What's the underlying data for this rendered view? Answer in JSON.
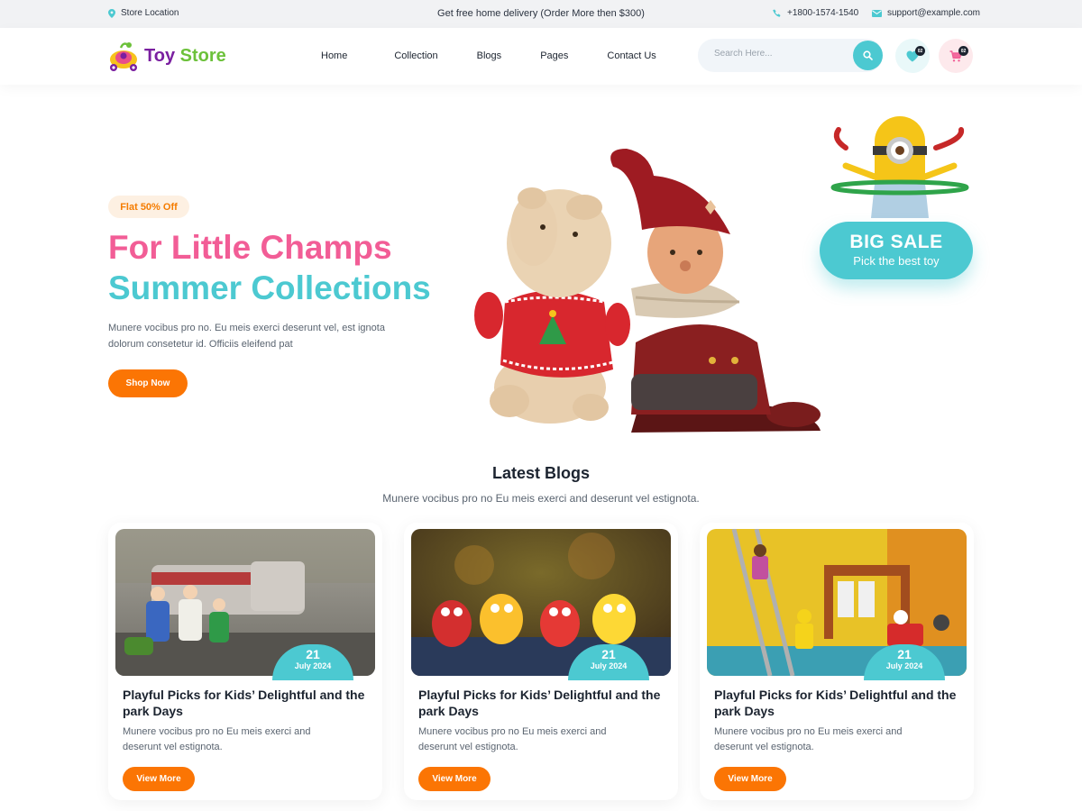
{
  "topbar": {
    "location": "Store Location",
    "promo": "Get free home delivery (Order More then $300)",
    "phone": "+1800-1574-1540",
    "email": "support@example.com"
  },
  "header": {
    "logo_part1": "Toy",
    "logo_part2": "Store",
    "nav": [
      "Home",
      "Collection",
      "Blogs",
      "Pages",
      "Contact Us"
    ],
    "search_placeholder": "Search Here...",
    "wishlist_count": "02",
    "cart_count": "02"
  },
  "hero": {
    "offer": "Flat 50% Off",
    "title_line1": "For Little Champs",
    "title_line2": "Summer Collections",
    "description": "Munere vocibus pro no. Eu meis exerci deserunt vel, est ignota dolorum consetetur id. Officiis eleifend pat",
    "button": "Shop Now",
    "sale_title": "BIG SALE",
    "sale_sub": "Pick the best toy"
  },
  "blogs": {
    "title": "Latest Blogs",
    "subtitle": "Munere vocibus pro no Eu meis exerci and deserunt vel estignota.",
    "posts": [
      {
        "day": "21",
        "month": "July 2024",
        "title": "Playful Picks for Kids’ Delightful and the park Days",
        "desc": "Munere vocibus pro no Eu meis exerci and deserunt vel estignota.",
        "button": "View More"
      },
      {
        "day": "21",
        "month": "July 2024",
        "title": "Playful Picks for Kids’ Delightful and the park Days",
        "desc": "Munere vocibus pro no Eu meis exerci and deserunt vel estignota.",
        "button": "View More"
      },
      {
        "day": "21",
        "month": "July 2024",
        "title": "Playful Picks for Kids’ Delightful and the park Days",
        "desc": "Munere vocibus pro no Eu meis exerci and deserunt vel estignota.",
        "button": "View More"
      }
    ]
  },
  "colors": {
    "accent_teal": "#4cc9d1",
    "accent_pink": "#f25d96",
    "accent_orange": "#fb7504",
    "logo_purple": "#7a1fa0",
    "logo_green": "#6cc13a"
  }
}
